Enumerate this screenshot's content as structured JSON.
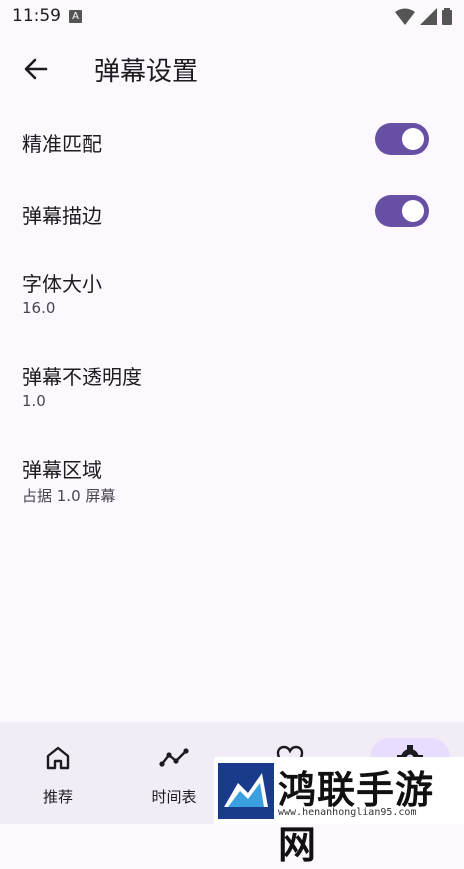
{
  "status_bar": {
    "time": "11:59",
    "notification_badge": "A"
  },
  "app_bar": {
    "title": "弹幕设置",
    "back_icon": "arrow-back-icon"
  },
  "settings": [
    {
      "title": "精准匹配",
      "type": "switch",
      "checked": true
    },
    {
      "title": "弹幕描边",
      "type": "switch",
      "checked": true
    },
    {
      "title": "字体大小",
      "subtitle": "16.0"
    },
    {
      "title": "弹幕不透明度",
      "subtitle": "1.0"
    },
    {
      "title": "弹幕区域",
      "subtitle": "占据 1.0 屏幕"
    }
  ],
  "bottom_nav": [
    {
      "label": "推荐",
      "icon": "home-icon"
    },
    {
      "label": "时间表",
      "icon": "timeline-icon"
    },
    {
      "label": "",
      "icon": "heart-icon"
    },
    {
      "label": "",
      "icon": "gear-icon",
      "selected": true
    }
  ],
  "watermark": {
    "text": "鸿联手游网",
    "url": "www.henanhonglian95.com"
  },
  "colors": {
    "accent": "#6750a4",
    "background": "#fdf7fe",
    "nav_background": "#f2ecf6",
    "pill": "#e9ddff"
  }
}
